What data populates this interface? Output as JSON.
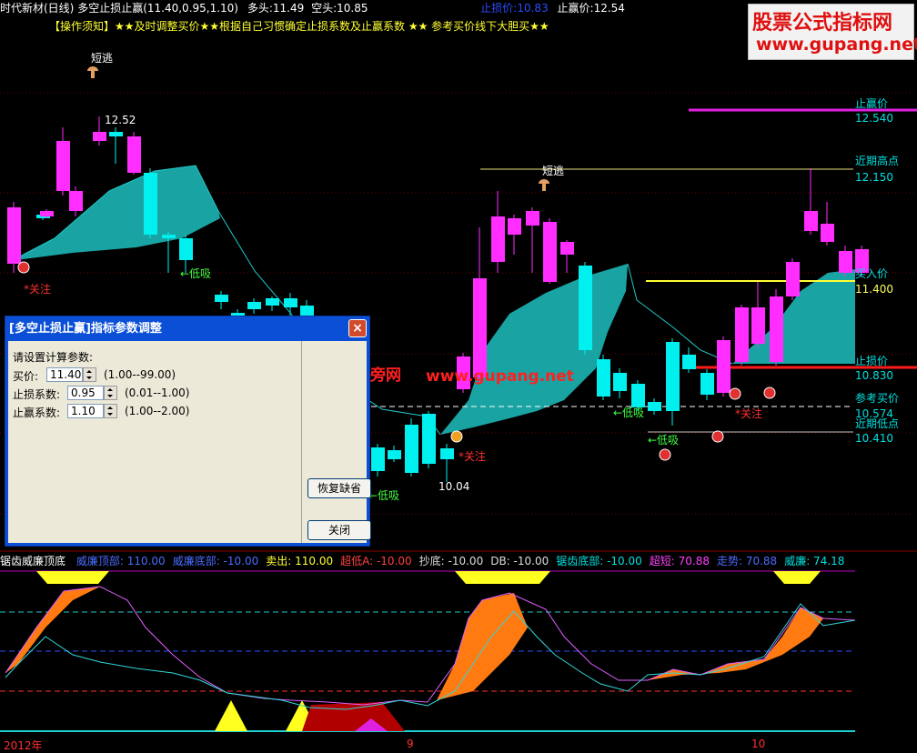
{
  "header": {
    "stock": "时代新材(日线)",
    "indicator": "多空止损止赢(11.40,0.95,1.10)",
    "long_label": "多头:",
    "long_value": "11.49",
    "short_label": "空头:",
    "short_value": "10.85",
    "stop_loss_label": "止损价:",
    "stop_loss_value": "10.83",
    "take_profit_label": "止赢价:",
    "take_profit_value": "12.54",
    "notice": "【操作须知】★★及时调整买价★★根据自己习惯确定止损系数及止赢系数 ★★ 参考买价线下大胆买★★"
  },
  "logo": {
    "line1": "股票公式指标网",
    "line2": "www.gupang.net"
  },
  "watermark": {
    "cn": "股旁网",
    "url": "www.gupang.net"
  },
  "annotations": {
    "peak_price": "12.52",
    "low_price": "10.04",
    "short_escape": "短逃",
    "low_buy": "←低吸",
    "attention": "*关注"
  },
  "right_labels": {
    "take_profit_title": "止赢价",
    "take_profit_value": "12.540",
    "recent_high_title": "近期高点",
    "recent_high_value": "12.150",
    "buy_title": "买入价",
    "buy_value": "11.400",
    "stop_loss_title": "止损价",
    "stop_loss_value": "10.830",
    "ref_buy_title": "参考买价",
    "ref_buy_value": "10.574",
    "recent_low_title": "近期低点",
    "recent_low_value": "10.410"
  },
  "lower_panel": {
    "name": "锯齿威廉顶底",
    "items": [
      {
        "label": "威廉顶部:",
        "value": "110.00",
        "color": "#4a6bff"
      },
      {
        "label": "威廉底部:",
        "value": "-10.00",
        "color": "#4a6bff"
      },
      {
        "label": "卖出:",
        "value": "110.00",
        "color": "#ffff33"
      },
      {
        "label": "超低A:",
        "value": "-10.00",
        "color": "#ff4040"
      },
      {
        "label": "抄底:",
        "value": "-10.00",
        "color": "#dddddd"
      },
      {
        "label": "DB:",
        "value": "-10.00",
        "color": "#dddddd"
      },
      {
        "label": "锯齿底部:",
        "value": "-10.00",
        "color": "#00e0e0"
      },
      {
        "label": "超短:",
        "value": "70.88",
        "color": "#ff40ff"
      },
      {
        "label": "走势:",
        "value": "70.88",
        "color": "#4a6bff"
      },
      {
        "label": "威廉:",
        "value": "74.18",
        "color": "#00e0e0"
      }
    ]
  },
  "x_axis": {
    "label_year": "2012年",
    "label_9": "9",
    "label_10": "10"
  },
  "dialog": {
    "title": "[多空止损止赢]指标参数调整",
    "prompt": "请设置计算参数:",
    "params": [
      {
        "label": "买价:",
        "value": "11.40",
        "range": "(1.00--99.00)"
      },
      {
        "label": "止损系数:",
        "value": "0.95",
        "range": "(0.01--1.00)"
      },
      {
        "label": "止赢系数:",
        "value": "1.10",
        "range": "(1.00--2.00)"
      }
    ],
    "restore_button": "恢复缺省",
    "close_button": "关闭",
    "close_icon": "×"
  },
  "colors": {
    "up": "#ff2dff",
    "down": "#00f0f0",
    "band": "#1aa3a3",
    "take_profit": "#e020e0",
    "stop_loss": "#ff1a1a",
    "buy": "#ffff33",
    "recent_high": "#e8e080",
    "ref_buy": "#ffffff"
  }
}
